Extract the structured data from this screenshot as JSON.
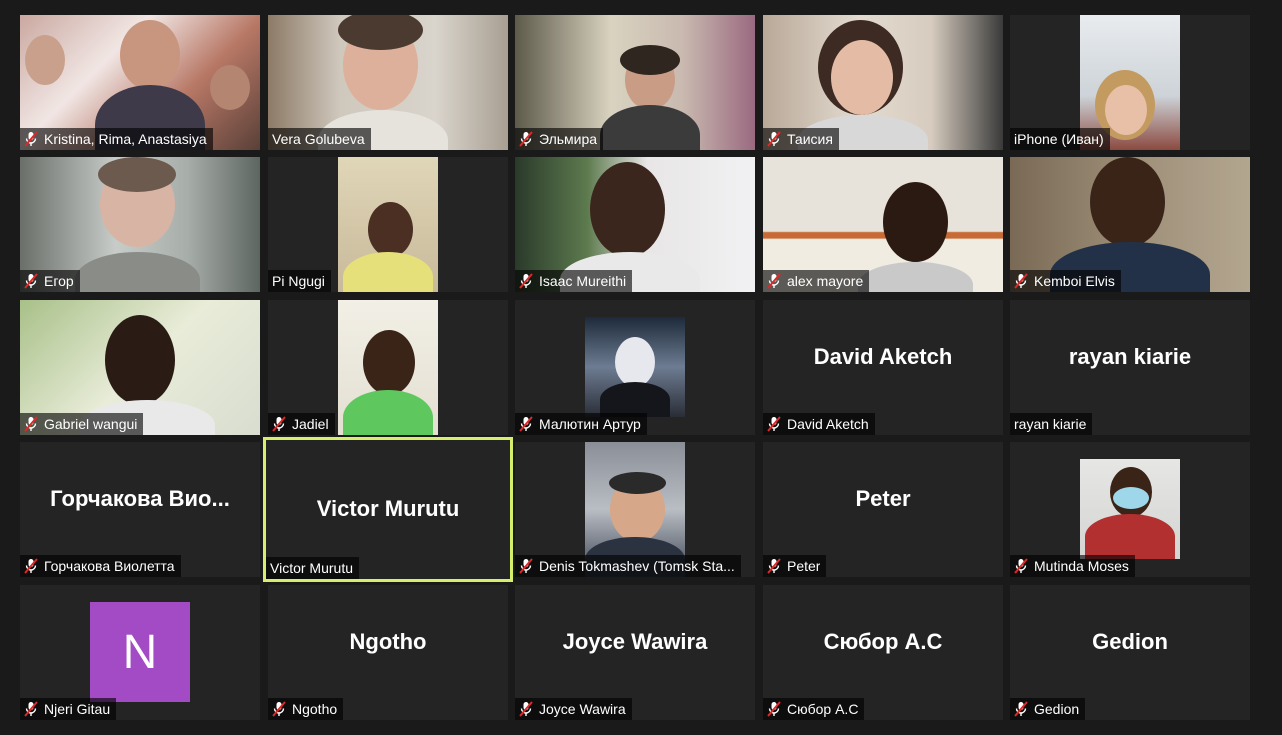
{
  "participants": [
    {
      "name": "Kristina, Rima, Anastasiya",
      "muted": true
    },
    {
      "name": "Vera Golubeva",
      "muted": false
    },
    {
      "name": "Эльмира",
      "muted": true
    },
    {
      "name": "Таисия",
      "muted": true
    },
    {
      "name": "iPhone (Иван)",
      "muted": false
    },
    {
      "name": "Егор",
      "muted": true
    },
    {
      "name": "Pi Ngugi",
      "muted": false
    },
    {
      "name": "Isaac Mureithi",
      "muted": true
    },
    {
      "name": "alex mayore",
      "muted": true
    },
    {
      "name": "Kemboi Elvis",
      "muted": true
    },
    {
      "name": "Gabriel wangui",
      "muted": true
    },
    {
      "name": "Jadiel",
      "muted": true
    },
    {
      "name": "Малютин Артур",
      "muted": true
    },
    {
      "name": "David Aketch",
      "display": "David Aketch",
      "muted": true
    },
    {
      "name": "rayan kiarie",
      "display": "rayan kiarie",
      "muted": false
    },
    {
      "name": "Горчакова Виолетта",
      "display": "Горчакова  Вио...",
      "muted": true
    },
    {
      "name": "Victor Murutu",
      "display": "Victor Murutu",
      "muted": false,
      "active_speaker": true
    },
    {
      "name": "Denis Tokmashev (Tomsk Sta...",
      "muted": true
    },
    {
      "name": "Peter",
      "display": "Peter",
      "muted": true
    },
    {
      "name": "Mutinda Moses",
      "muted": true
    },
    {
      "name": "Njeri Gitau",
      "avatar_letter": "N",
      "muted": true
    },
    {
      "name": "Ngotho",
      "display": "Ngotho",
      "muted": true
    },
    {
      "name": "Joyce Wawira",
      "display": "Joyce Wawira",
      "muted": true
    },
    {
      "name": "Сюбор А.С",
      "display": "Сюбор А.С",
      "muted": true
    },
    {
      "name": "Gedion",
      "display": "Gedion",
      "muted": true
    }
  ],
  "colors": {
    "background": "#1a1a1a",
    "tile": "#242424",
    "active_speaker_border": "#d6ee6e",
    "muted_icon": "#e02828",
    "avatar_purple": "#a24bc4"
  },
  "icons": {
    "muted": "mic-muted-icon"
  }
}
